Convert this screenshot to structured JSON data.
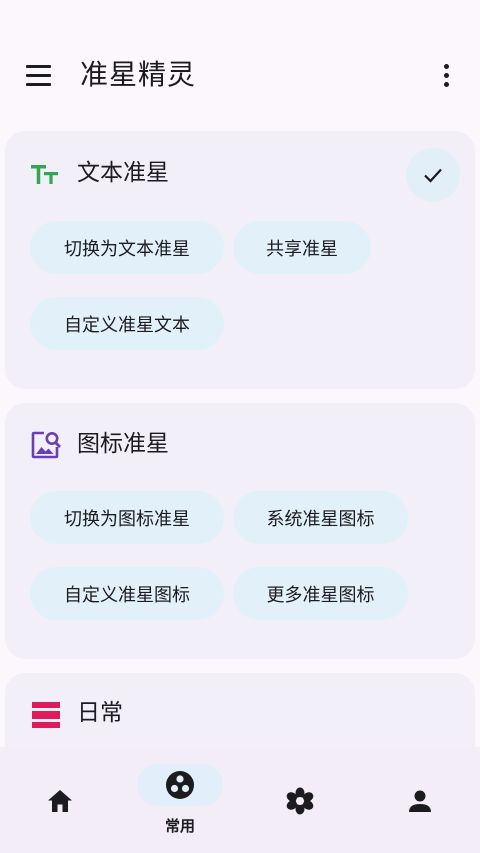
{
  "app": {
    "title": "准星精灵"
  },
  "sections": [
    {
      "title": "文本准星",
      "icon": "text-format-icon",
      "selected": true,
      "actions": [
        "切换为文本准星",
        "共享准星",
        "自定义准星文本"
      ]
    },
    {
      "title": "图标准星",
      "icon": "image-search-icon",
      "actions": [
        "切换为图标准星",
        "系统准星图标",
        "自定义准星图标",
        "更多准星图标"
      ]
    },
    {
      "title": "日常",
      "icon": "daily-list-icon",
      "actions": []
    }
  ],
  "nav": {
    "items": [
      {
        "icon": "home-icon",
        "label": ""
      },
      {
        "icon": "crosshair-icon",
        "label": "常用",
        "active": true
      },
      {
        "icon": "flower-icon",
        "label": ""
      },
      {
        "icon": "person-icon",
        "label": ""
      }
    ]
  },
  "colors": {
    "background": "#FCF7FD",
    "card": "#F2EFF9",
    "chip": "#E2F0FA",
    "text_icon": "#2FA84F",
    "image_icon": "#6A3FB4",
    "daily_icon": "#E0195B"
  }
}
